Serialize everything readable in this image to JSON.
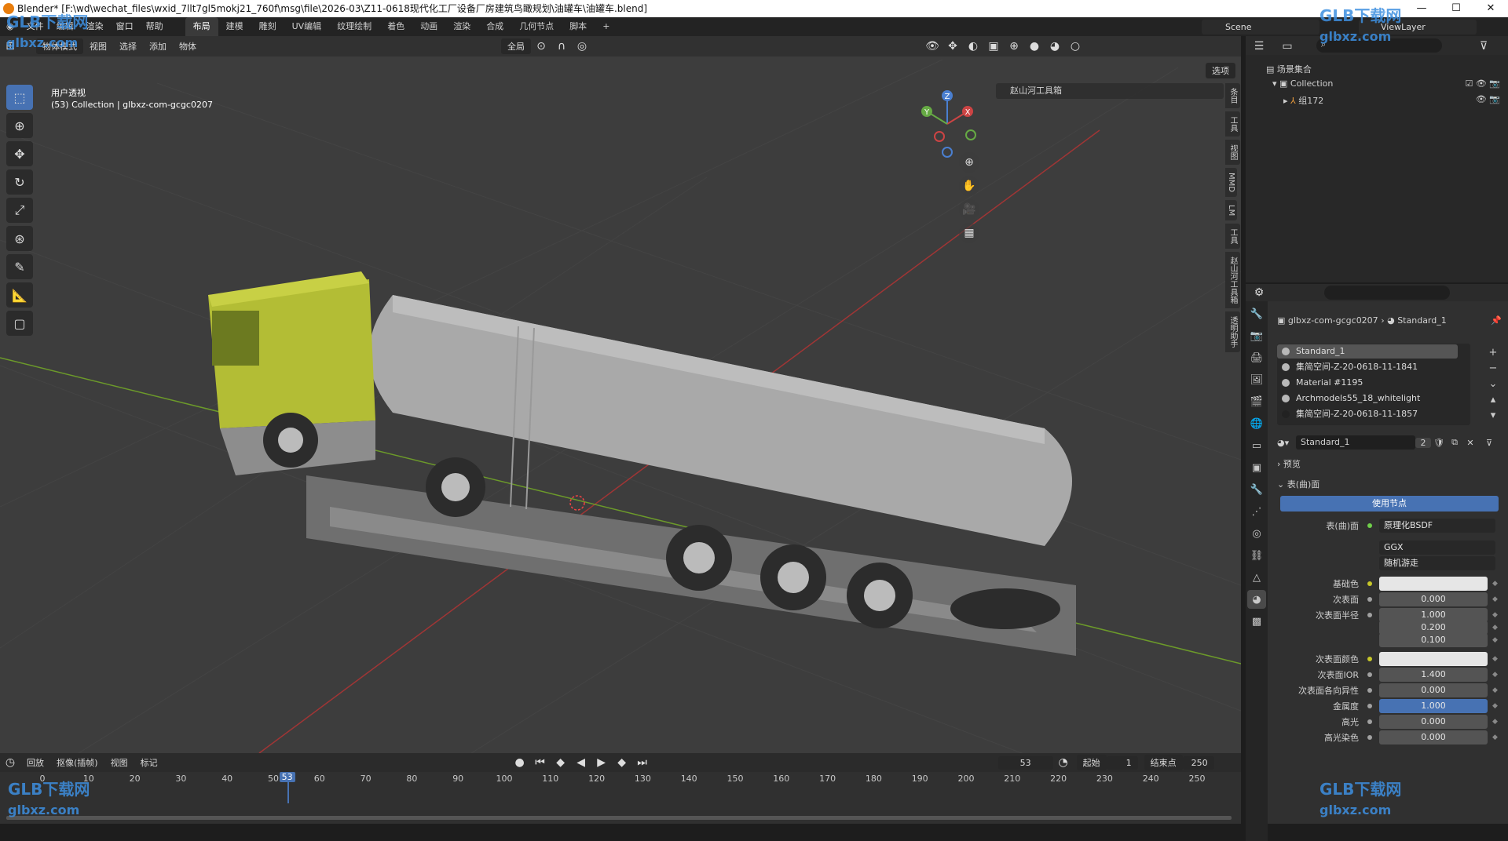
{
  "titlebar": {
    "text": "Blender* [F:\\wd\\wechat_files\\wxid_7llt7gl5mokj21_760f\\msg\\file\\2026-03\\Z11-0618现代化工厂设备厂房建筑鸟瞰规划\\油罐车\\油罐车.blend]",
    "min": "—",
    "max": "☐",
    "close": "✕"
  },
  "menubar": {
    "menus": [
      "文件",
      "编辑",
      "渲染",
      "窗口",
      "帮助"
    ],
    "workspaces": [
      "布局",
      "建模",
      "雕刻",
      "UV编辑",
      "纹理绘制",
      "着色",
      "动画",
      "渲染",
      "合成",
      "几何节点",
      "脚本"
    ],
    "active_workspace": "布局",
    "add_tab": "+",
    "scene": "Scene",
    "view_layer": "ViewLayer"
  },
  "viewport": {
    "mode": "物体模式",
    "menus": [
      "视图",
      "选择",
      "添加",
      "物体"
    ],
    "orientation": "全局",
    "options": "选项",
    "view_name": "用户透视",
    "collection_info": "(53) Collection | glbxz-com-gcgc0207",
    "addon_panel": "赵山河工具箱",
    "n_tabs": [
      "条目",
      "工具",
      "视图",
      "MMD",
      "LM",
      "工具",
      "赵山河工具箱",
      "透明助手"
    ],
    "gizmo": {
      "z": "Z",
      "x": "X",
      "y": "Y"
    }
  },
  "outliner": {
    "root": "场景集合",
    "collection": "Collection",
    "object": "组172"
  },
  "properties": {
    "breadcrumb_object": "glbxz-com-gcgc0207",
    "breadcrumb_material": "Standard_1",
    "materials": [
      "Standard_1",
      "集简空间-Z-20-0618-11-1841",
      "Material #1195",
      "Archmodels55_18_whitelight",
      "集简空间-Z-20-0618-11-1857"
    ],
    "material_name": "Standard_1",
    "material_users": "2",
    "preview_label": "预览",
    "surface_label": "表(曲)面",
    "use_nodes": "使用节点",
    "surface_field_label": "表(曲)面",
    "surface_shader": "原理化BSDF",
    "distribution": "GGX",
    "subsurface_method": "随机游走",
    "fields": [
      {
        "label": "基础色",
        "value": "",
        "type": "color"
      },
      {
        "label": "次表面",
        "value": "0.000",
        "type": "num"
      },
      {
        "label": "次表面半径",
        "value": "1.000",
        "type": "num"
      },
      {
        "label": "",
        "value": "0.200",
        "type": "num"
      },
      {
        "label": "",
        "value": "0.100",
        "type": "num"
      },
      {
        "label": "次表面颜色",
        "value": "",
        "type": "color"
      },
      {
        "label": "次表面IOR",
        "value": "1.400",
        "type": "num"
      },
      {
        "label": "次表面各向异性",
        "value": "0.000",
        "type": "num"
      },
      {
        "label": "金属度",
        "value": "1.000",
        "type": "blue"
      },
      {
        "label": "高光",
        "value": "0.000",
        "type": "num"
      },
      {
        "label": "高光染色",
        "value": "0.000",
        "type": "num"
      }
    ]
  },
  "timeline": {
    "menus": [
      "回放",
      "抠像(插帧)",
      "视图",
      "标记"
    ],
    "current_frame": "53",
    "start_label": "起始",
    "start": "1",
    "end_label": "结束点",
    "end": "250",
    "ticks": [
      "0",
      "10",
      "20",
      "30",
      "40",
      "50",
      "60",
      "70",
      "80",
      "90",
      "100",
      "110",
      "120",
      "130",
      "140",
      "150",
      "160",
      "170",
      "180",
      "190",
      "200",
      "210",
      "220",
      "230",
      "240",
      "250"
    ],
    "playhead": "53"
  },
  "watermark": {
    "brand": "GLB下载网",
    "url": "glbxz.com"
  },
  "colors": {
    "accent": "#4772b3",
    "cab": "#b3bd35",
    "tank": "#a9a9a9",
    "grid_x": "#a03535",
    "grid_y": "#6c9a2a"
  }
}
